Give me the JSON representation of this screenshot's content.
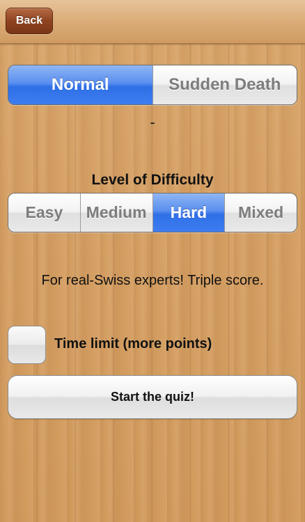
{
  "navbar": {
    "back_label": "Back"
  },
  "mode": {
    "options": [
      "Normal",
      "Sudden Death"
    ],
    "selected_index": 0
  },
  "separator": "-",
  "difficulty": {
    "label": "Level of Difficulty",
    "options": [
      "Easy",
      "Medium",
      "Hard",
      "Mixed"
    ],
    "selected_index": 2,
    "description": "For real-Swiss experts! Triple score."
  },
  "time_limit": {
    "label": "Time limit (more points)",
    "checked": false
  },
  "start_label": "Start the quiz!",
  "colors": {
    "accent_blue": "#2f6fe6",
    "back_button_brown": "#8f4421",
    "wood": "#d6a064"
  }
}
